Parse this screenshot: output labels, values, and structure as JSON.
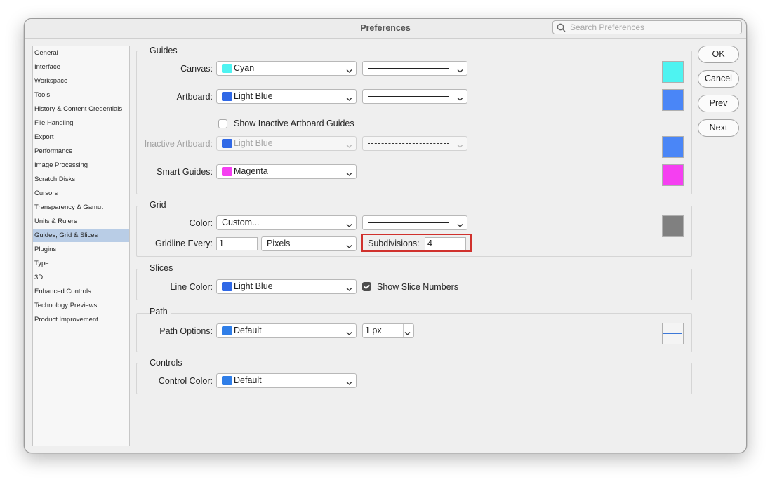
{
  "window": {
    "title": "Preferences"
  },
  "search": {
    "placeholder": "Search Preferences",
    "icon": "magnifier"
  },
  "sidebar": {
    "items": [
      {
        "label": "General"
      },
      {
        "label": "Interface"
      },
      {
        "label": "Workspace"
      },
      {
        "label": "Tools"
      },
      {
        "label": "History & Content Credentials"
      },
      {
        "label": "File Handling"
      },
      {
        "label": "Export"
      },
      {
        "label": "Performance"
      },
      {
        "label": "Image Processing"
      },
      {
        "label": "Scratch Disks"
      },
      {
        "label": "Cursors"
      },
      {
        "label": "Transparency & Gamut"
      },
      {
        "label": "Units & Rulers"
      },
      {
        "label": "Guides, Grid & Slices"
      },
      {
        "label": "Plugins"
      },
      {
        "label": "Type"
      },
      {
        "label": "3D"
      },
      {
        "label": "Enhanced Controls"
      },
      {
        "label": "Technology Previews"
      },
      {
        "label": "Product Improvement"
      }
    ],
    "selected": "Guides, Grid & Slices"
  },
  "guides": {
    "title": "Guides",
    "canvas": {
      "label": "Canvas:",
      "color": "Cyan",
      "swatch": "#4ef3f1",
      "style": "solid"
    },
    "artboard": {
      "label": "Artboard:",
      "color": "Light Blue",
      "swatch": "#4a86f7",
      "style": "solid"
    },
    "show_inactive": {
      "label": "Show Inactive Artboard Guides",
      "checked": false
    },
    "inactive_artboard": {
      "label": "Inactive Artboard:",
      "color": "Light Blue",
      "swatch": "#4a86f7",
      "style": "dashed",
      "disabled": true
    },
    "smart_guides": {
      "label": "Smart Guides:",
      "color": "Magenta",
      "swatch": "#f53ff1"
    }
  },
  "grid": {
    "title": "Grid",
    "color": {
      "label": "Color:",
      "value": "Custom...",
      "swatch": "#808080",
      "style": "solid"
    },
    "gridline": {
      "label": "Gridline Every:",
      "value": "1",
      "unit": "Pixels"
    },
    "subdivisions": {
      "label": "Subdivisions:",
      "value": "4",
      "highlight": "#d0312d"
    }
  },
  "slices": {
    "title": "Slices",
    "line_color": {
      "label": "Line Color:",
      "value": "Light Blue",
      "swatch": "#2f68e6"
    },
    "show_numbers": {
      "label": "Show Slice Numbers",
      "checked": true
    }
  },
  "path": {
    "title": "Path",
    "options": {
      "label": "Path Options:",
      "value": "Default",
      "swatch": "#2f7ee8"
    },
    "width": "1 px"
  },
  "controls": {
    "title": "Controls",
    "color": {
      "label": "Control Color:",
      "value": "Default",
      "swatch": "#2f7ee8"
    }
  },
  "buttons": {
    "ok": "OK",
    "cancel": "Cancel",
    "prev": "Prev",
    "next": "Next"
  }
}
